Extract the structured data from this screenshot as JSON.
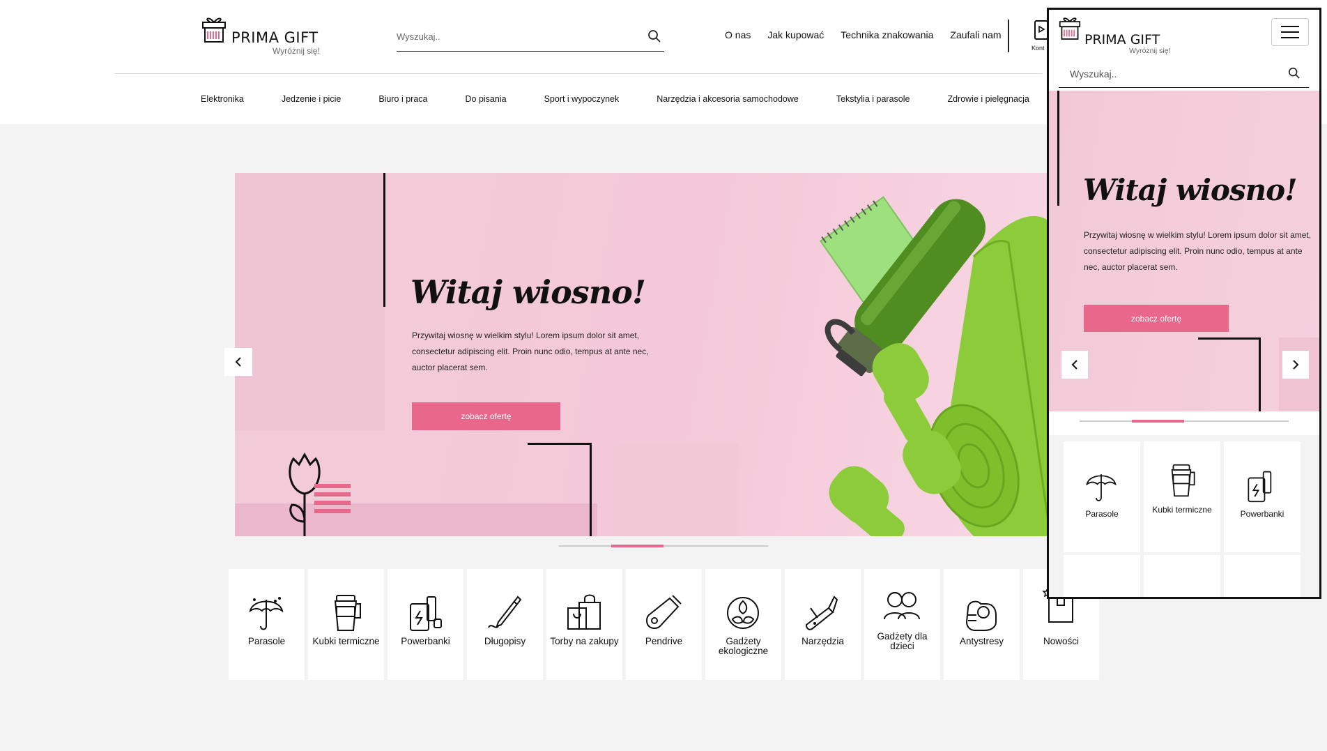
{
  "brand": {
    "name": "PRIMA GIFT",
    "tagline": "Wyróżnij się!"
  },
  "search": {
    "placeholder": "Wyszukaj.."
  },
  "top_nav": [
    {
      "label": "O nas"
    },
    {
      "label": "Jak kupować"
    },
    {
      "label": "Technika znakowania"
    },
    {
      "label": "Zaufali nam"
    }
  ],
  "contact": {
    "label": "Kont"
  },
  "category_nav": [
    {
      "label": "Elektronika"
    },
    {
      "label": "Jedzenie i picie"
    },
    {
      "label": "Biuro i praca"
    },
    {
      "label": "Do pisania"
    },
    {
      "label": "Sport i wypoczynek"
    },
    {
      "label": "Narzędzia i akcesoria samochodowe"
    },
    {
      "label": "Tekstylia i parasole"
    },
    {
      "label": "Zdrowie i pielęgnacja"
    }
  ],
  "hero": {
    "title": "Witaj wiosno!",
    "text": "Przywitaj wiosnę w wielkim stylu! Lorem ipsum dolor sit amet, consectetur adipiscing elit. Proin nunc odio, tempus at ante nec, auctor placerat sem.",
    "cta": "zobacz ofertę",
    "slide_index": 2,
    "slide_count": 4
  },
  "tiles": [
    {
      "label": "Parasole",
      "icon": "umbrella-icon"
    },
    {
      "label": "Kubki termiczne",
      "icon": "thermal-mug-icon"
    },
    {
      "label": "Powerbanki",
      "icon": "powerbank-icon"
    },
    {
      "label": "Długopisy",
      "icon": "pen-icon"
    },
    {
      "label": "Torby na zakupy",
      "icon": "shopping-bag-icon"
    },
    {
      "label": "Pendrive",
      "icon": "usb-drive-icon"
    },
    {
      "label": "Gadżety ekologiczne",
      "icon": "eco-leaves-icon"
    },
    {
      "label": "Narzędzia",
      "icon": "multitool-icon"
    },
    {
      "label": "Gadżety dla dzieci",
      "icon": "children-icon"
    },
    {
      "label": "Antystresy",
      "icon": "stress-ball-icon"
    },
    {
      "label": "Nowości",
      "icon": "new-box-icon"
    }
  ],
  "mobile": {
    "tiles": [
      {
        "label": "Parasole",
        "icon": "umbrella-icon"
      },
      {
        "label": "Kubki termiczne",
        "icon": "thermal-mug-icon"
      },
      {
        "label": "Powerbanki",
        "icon": "powerbank-icon"
      }
    ]
  },
  "colors": {
    "accent": "#e9678a",
    "hero_bg": "#f4c8d8",
    "page_bg": "#f3f3f3",
    "green": "#8ccc3a"
  }
}
